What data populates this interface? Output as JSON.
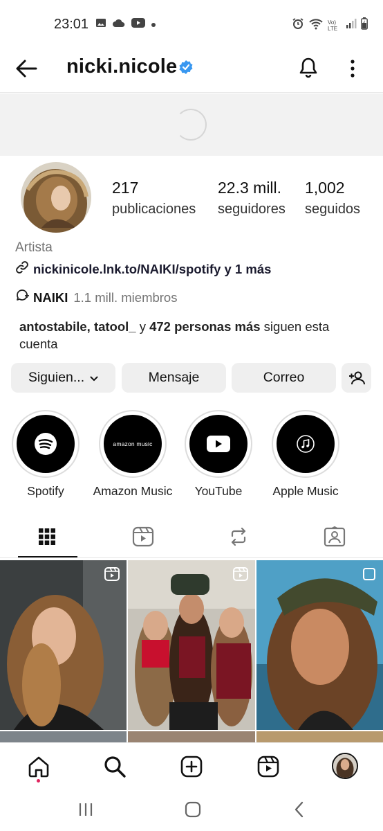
{
  "status_bar": {
    "time": "23:01",
    "network_label": "Vo) LTE"
  },
  "header": {
    "username": "nicki.nicole",
    "verified_icon": "verified-badge-icon"
  },
  "profile": {
    "posts_count": "217",
    "posts_label": "publicaciones",
    "followers_count": "22.3 mill.",
    "followers_label": "seguidores",
    "following_count": "1,002",
    "following_label": "seguidos",
    "category": "Artista",
    "link": "nickinicole.lnk.to/NAIKI/spotify y 1 más",
    "channel_name": "NAIKI",
    "channel_members": "1.1 mill. miembros",
    "followed_by_names": "antostabile, tatool_",
    "followed_by_mid": " y ",
    "followed_by_count": "472 personas más",
    "followed_by_tail": " siguen esta cuenta"
  },
  "actions": {
    "following_label": "Siguien...",
    "message_label": "Mensaje",
    "email_label": "Correo"
  },
  "highlights": [
    {
      "label": "Spotify",
      "icon": "spotify-icon"
    },
    {
      "label": "Amazon Music",
      "icon": "amazon-music-logo",
      "logo_text": "amazon music"
    },
    {
      "label": "YouTube",
      "icon": "youtube-icon"
    },
    {
      "label": "Apple Music",
      "icon": "music-note-icon"
    }
  ],
  "tabs": [
    "grid-icon",
    "reels-icon",
    "reposts-icon",
    "tagged-icon"
  ],
  "colors": {
    "verified": "#3897f0",
    "notification_dot": "#e0245e",
    "button_bg": "#efefef"
  }
}
